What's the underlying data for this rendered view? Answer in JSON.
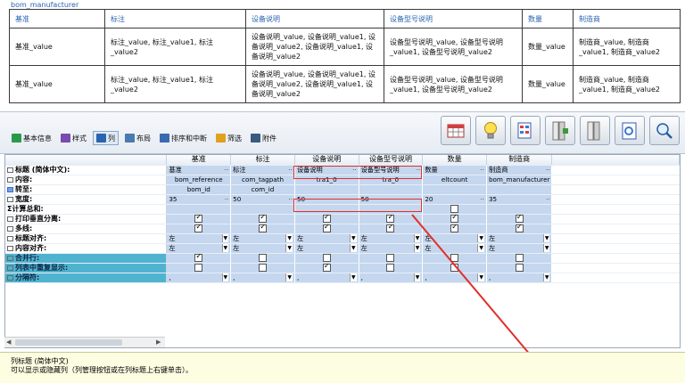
{
  "report": {
    "caption": "bom_manufacturer",
    "headers": [
      "基准",
      "标注",
      "设备说明",
      "设备型号说明",
      "数量",
      "制造商"
    ],
    "rows": [
      [
        "基准_value",
        "标注_value, 标注_value1, 标注_value2",
        "设备说明_value, 设备说明_value1, 设备说明_value2, 设备说明_value1, 设备说明_value2",
        "设备型号说明_value, 设备型号说明_value1, 设备型号说明_value2",
        "数量_value",
        "制造商_value, 制造商_value1, 制造商_value2"
      ],
      [
        "基准_value",
        "标注_value, 标注_value1, 标注_value2",
        "设备说明_value, 设备说明_value1, 设备说明_value2, 设备说明_value1, 设备说明_value2",
        "设备型号说明_value, 设备型号说明_value1, 设备型号说明_value2",
        "数量_value",
        "制造商_value, 制造商_value1, 制造商_value2"
      ]
    ]
  },
  "tabs": [
    {
      "label": "基本信息",
      "icon": "info-icon",
      "color": "#2a9a4a"
    },
    {
      "label": "样式",
      "icon": "brush-icon",
      "color": "#7a4ab0"
    },
    {
      "label": "列",
      "icon": "columns-icon",
      "color": "#2a64b0",
      "active": true
    },
    {
      "label": "布局",
      "icon": "layout-icon",
      "color": "#4a7ab0"
    },
    {
      "label": "排序和中断",
      "icon": "sort-icon",
      "color": "#3a6ab0"
    },
    {
      "label": "筛选",
      "icon": "filter-icon",
      "color": "#e0a020"
    },
    {
      "label": "附件",
      "icon": "attachment-icon",
      "color": "#3a5a80"
    }
  ],
  "tools": [
    "table-icon",
    "lightbulb-icon",
    "form-icon",
    "column-insert-icon",
    "column-delete-icon",
    "preview-icon",
    "zoom-icon"
  ],
  "grid": {
    "columns": [
      "基准",
      "标注",
      "设备说明",
      "设备型号说明",
      "数量",
      "制造商"
    ],
    "rows": {
      "title": {
        "label": "标题 (简体中文):",
        "values": [
          "基准",
          "标注",
          "设备说明",
          "设备型号说明",
          "数量",
          "制造商"
        ]
      },
      "content": {
        "label": "内容:",
        "values": [
          "bom_reference",
          "com_tagpath",
          "tra1_0",
          "tra_0",
          "eltcount",
          "bom_manufacturer"
        ]
      },
      "goto": {
        "label": "转至:",
        "values": [
          "bom_id",
          "com_id",
          "",
          "",
          "",
          ""
        ]
      },
      "width": {
        "label": "宽度:",
        "values": [
          "35",
          "50",
          "50",
          "50",
          "20",
          "35"
        ]
      },
      "sum": {
        "label": "计算总和:"
      },
      "vsplit": {
        "label": "打印垂直分离:",
        "checked": [
          true,
          true,
          true,
          true,
          true,
          true
        ]
      },
      "multiline": {
        "label": "多线:",
        "checked": [
          true,
          true,
          true,
          true,
          true,
          true
        ]
      },
      "title_align": {
        "label": "标题对齐:",
        "values": [
          "左",
          "左",
          "左",
          "左",
          "左",
          "左"
        ]
      },
      "content_align": {
        "label": "内容对齐:",
        "values": [
          "左",
          "左",
          "左",
          "左",
          "左",
          "左"
        ]
      },
      "merge": {
        "label": "合并行:",
        "checked": [
          true,
          false,
          false,
          false,
          false,
          false
        ]
      },
      "repeat": {
        "label": "列表中重复显示:",
        "checked": [
          false,
          false,
          true,
          false,
          false,
          false
        ]
      },
      "separator": {
        "label": "分隔符:",
        "values": [
          ",",
          ",",
          ",",
          ",",
          ",",
          ","
        ]
      }
    }
  },
  "help": {
    "title": "列标题 (简体中文)",
    "text": "可以显示或隐藏列（列管理按钮或在列标题上右键单击）。"
  },
  "colors": {
    "accent": "#2a64b0",
    "cell": "#c5d7ef",
    "highlight": "#e0302a",
    "teal": "#4fb3d0"
  }
}
